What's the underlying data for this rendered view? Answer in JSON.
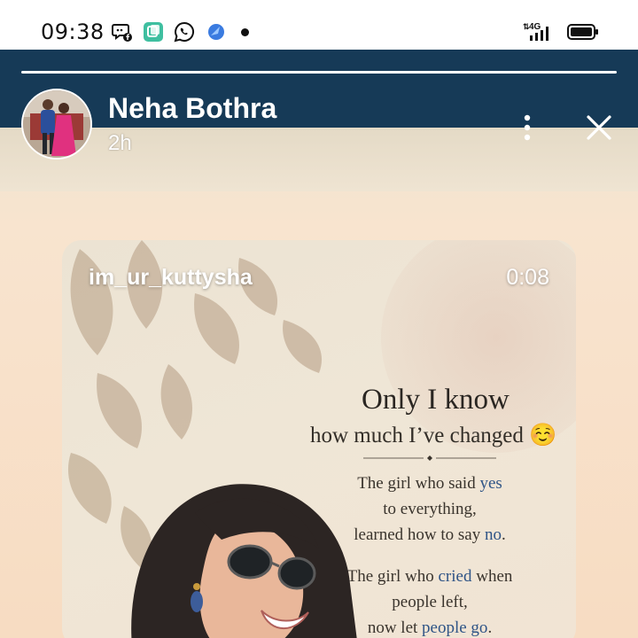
{
  "status_bar": {
    "time": "09:38",
    "icons": [
      "messenger-facebook-icon",
      "copy-app-icon",
      "whatsapp-icon",
      "browser-icon",
      "notification-dot-icon"
    ],
    "network_label": "4G",
    "signal_icon": "signal-icon",
    "battery_icon": "battery-icon"
  },
  "story": {
    "username": "Neha Bothra",
    "time_ago": "2h",
    "progress_color": "#ffffff",
    "header_color": "#163a57"
  },
  "post": {
    "handle": "im_ur_kuttysha",
    "duration": "0:08",
    "title": "Only I know",
    "subtitle": "how much I’ve changed",
    "emoji": "☺️",
    "stanza1": [
      {
        "parts": [
          [
            "The girl who said ",
            false
          ],
          [
            "yes",
            true
          ]
        ]
      },
      {
        "parts": [
          [
            "to everything,",
            false
          ]
        ]
      },
      {
        "parts": [
          [
            "learned how to say ",
            false
          ],
          [
            "no",
            true
          ],
          [
            ".",
            false
          ]
        ]
      }
    ],
    "stanza2": [
      {
        "parts": [
          [
            "The girl who ",
            false
          ],
          [
            "cried",
            true
          ],
          [
            " when",
            false
          ]
        ]
      },
      {
        "parts": [
          [
            "people left,",
            false
          ]
        ]
      },
      {
        "parts": [
          [
            "now let ",
            false
          ],
          [
            "people go",
            true
          ],
          [
            ".",
            false
          ]
        ]
      }
    ],
    "highlight_color": "#2f5486"
  }
}
